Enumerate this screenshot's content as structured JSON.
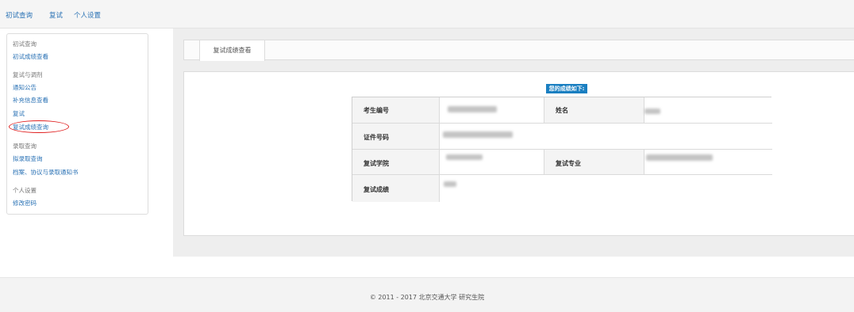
{
  "topnav": {
    "items": [
      "初试查询",
      "复试",
      "个人设置"
    ]
  },
  "sidebar": {
    "sections": [
      {
        "heading": "初试查询",
        "links": [
          "初试成绩查看"
        ]
      },
      {
        "heading": "复试与调剂",
        "links": [
          "通知公告",
          "补充信息查看",
          "复试",
          "复试成绩查询"
        ]
      },
      {
        "heading": "录取查询",
        "links": [
          "拟录取查询",
          "档案、协议与录取通知书"
        ]
      },
      {
        "heading": "个人设置",
        "links": [
          "修改密码"
        ]
      }
    ],
    "highlighted_link": "复试成绩查询"
  },
  "tab": {
    "label": "复试成绩查看"
  },
  "result": {
    "title": "您的成绩如下:",
    "labels": {
      "exam_no": "考生编号",
      "name": "姓名",
      "id_no": "证件号码",
      "college": "复试学院",
      "major": "复试专业",
      "score": "复试成绩"
    }
  },
  "footer": {
    "text": "© 2011 - 2017 北京交通大学 研究生院"
  },
  "colors": {
    "link": "#2a72b5",
    "title_badge": "#1a7fc1",
    "highlight_ring": "#e02020"
  }
}
